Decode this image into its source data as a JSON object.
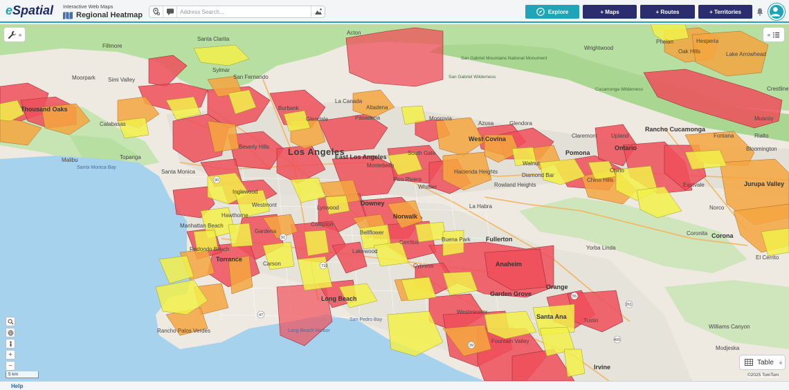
{
  "header": {
    "logo_e": "e",
    "logo_rest": "Spatial",
    "subtitle": "Interactive Web Maps",
    "map_title": "Regional Heatmap",
    "search_placeholder": "Address Search...",
    "buttons": {
      "explore": "Explore",
      "maps": "+ Maps",
      "routes": "+ Routes",
      "territories": "+ Territories"
    }
  },
  "map": {
    "places": [
      {
        "label": "Acton",
        "style": "normal"
      },
      {
        "label": "Fillmore",
        "style": "normal"
      },
      {
        "label": "Santa Clarita",
        "style": "normal"
      },
      {
        "label": "Simi Valley",
        "style": "normal"
      },
      {
        "label": "Moorpark",
        "style": "normal"
      },
      {
        "label": "Thousand Oaks",
        "style": "mid"
      },
      {
        "label": "San Fernando",
        "style": "normal"
      },
      {
        "label": "Sylmar",
        "style": "normal"
      },
      {
        "label": "Burbank",
        "style": "normal"
      },
      {
        "label": "Glendale",
        "style": "normal"
      },
      {
        "label": "Pasadena",
        "style": "normal"
      },
      {
        "label": "La Canada",
        "style": "normal"
      },
      {
        "label": "Altadena",
        "style": "normal"
      },
      {
        "label": "Monrovia",
        "style": "normal"
      },
      {
        "label": "Azusa",
        "style": "normal"
      },
      {
        "label": "Glendora",
        "style": "normal"
      },
      {
        "label": "Los Angeles",
        "style": "big"
      },
      {
        "label": "East Los Angeles",
        "style": "mid"
      },
      {
        "label": "Beverly Hills",
        "style": "normal"
      },
      {
        "label": "Santa Monica",
        "style": "normal"
      },
      {
        "label": "Malibu",
        "style": "normal"
      },
      {
        "label": "Topanga",
        "style": "normal"
      },
      {
        "label": "Calabasas",
        "style": "normal"
      },
      {
        "label": "Inglewood",
        "style": "normal"
      },
      {
        "label": "Westmont",
        "style": "normal"
      },
      {
        "label": "Hawthorne",
        "style": "normal"
      },
      {
        "label": "Manhattan Beach",
        "style": "normal"
      },
      {
        "label": "Redondo Beach",
        "style": "normal"
      },
      {
        "label": "Torrance",
        "style": "mid"
      },
      {
        "label": "Carson",
        "style": "normal"
      },
      {
        "label": "Compton",
        "style": "normal"
      },
      {
        "label": "Lynwood",
        "style": "normal"
      },
      {
        "label": "Gardena",
        "style": "normal"
      },
      {
        "label": "Downey",
        "style": "mid"
      },
      {
        "label": "Norwalk",
        "style": "mid"
      },
      {
        "label": "Bellflower",
        "style": "normal"
      },
      {
        "label": "Cerritos",
        "style": "normal"
      },
      {
        "label": "Lakewood",
        "style": "normal"
      },
      {
        "label": "Long Beach",
        "style": "mid"
      },
      {
        "label": "Whittier",
        "style": "normal"
      },
      {
        "label": "La Habra",
        "style": "normal"
      },
      {
        "label": "Fullerton",
        "style": "mid"
      },
      {
        "label": "Anaheim",
        "style": "mid"
      },
      {
        "label": "Orange",
        "style": "mid"
      },
      {
        "label": "Garden Grove",
        "style": "mid"
      },
      {
        "label": "Santa Ana",
        "style": "mid"
      },
      {
        "label": "Westminster",
        "style": "normal"
      },
      {
        "label": "Fountain Valley",
        "style": "normal"
      },
      {
        "label": "Tustin",
        "style": "normal"
      },
      {
        "label": "Irvine",
        "style": "mid"
      },
      {
        "label": "Cypress",
        "style": "normal"
      },
      {
        "label": "Buena Park",
        "style": "normal"
      },
      {
        "label": "West Covina",
        "style": "mid"
      },
      {
        "label": "Walnut",
        "style": "normal"
      },
      {
        "label": "Diamond Bar",
        "style": "normal"
      },
      {
        "label": "Rowland Heights",
        "style": "normal"
      },
      {
        "label": "Hacienda Heights",
        "style": "normal"
      },
      {
        "label": "Pomona",
        "style": "mid"
      },
      {
        "label": "Chino",
        "style": "normal"
      },
      {
        "label": "Chino Hills",
        "style": "normal"
      },
      {
        "label": "Ontario",
        "style": "mid"
      },
      {
        "label": "Upland",
        "style": "normal"
      },
      {
        "label": "Claremont",
        "style": "normal"
      },
      {
        "label": "Rancho Cucamonga",
        "style": "mid"
      },
      {
        "label": "Fontana",
        "style": "normal"
      },
      {
        "label": "Rialto",
        "style": "normal"
      },
      {
        "label": "Bloomington",
        "style": "normal"
      },
      {
        "label": "Jurupa Valley",
        "style": "mid"
      },
      {
        "label": "Eastvale",
        "style": "normal"
      },
      {
        "label": "Norco",
        "style": "normal"
      },
      {
        "label": "Corona",
        "style": "mid"
      },
      {
        "label": "Coronita",
        "style": "normal"
      },
      {
        "label": "El Cerrito",
        "style": "normal"
      },
      {
        "label": "Yorba Linda",
        "style": "normal"
      },
      {
        "label": "Phelan",
        "style": "normal"
      },
      {
        "label": "Hesperia",
        "style": "normal"
      },
      {
        "label": "Oak Hills",
        "style": "normal"
      },
      {
        "label": "Lake Arrowhead",
        "style": "normal"
      },
      {
        "label": "Crestline",
        "style": "normal"
      },
      {
        "label": "Muscoy",
        "style": "normal"
      },
      {
        "label": "Wrightwood",
        "style": "normal"
      },
      {
        "label": "Williams Canyon",
        "style": "normal"
      },
      {
        "label": "Modjeska",
        "style": "normal"
      },
      {
        "label": "Rancho Palos Verdes",
        "style": "normal"
      },
      {
        "label": "Santa Monica Bay",
        "style": "water"
      },
      {
        "label": "San Pedro Bay",
        "style": "water"
      },
      {
        "label": "Long Beach Harbor",
        "style": "water"
      },
      {
        "label": "San Gabriel Mountains National Monument",
        "style": "wild"
      },
      {
        "label": "San Gabriel Wilderness",
        "style": "wild"
      },
      {
        "label": "Cucamonga Wilderness",
        "style": "wild"
      },
      {
        "label": "Pico Rivera",
        "style": "normal"
      },
      {
        "label": "South Gate",
        "style": "normal"
      },
      {
        "label": "Montebello",
        "style": "normal"
      }
    ],
    "scale_label": "5 km",
    "copyright": "©2025 TomTom",
    "table_button": "Table"
  },
  "footer": {
    "help": "Help"
  },
  "colors": {
    "accent": "#20a5b8",
    "nav_button": "#2b2d6e",
    "heat_high": "#ef4f5a",
    "heat_mid": "#f4a640",
    "heat_low": "#f2f04a",
    "water": "#a6d2ee",
    "park": "#b7dfa1"
  }
}
